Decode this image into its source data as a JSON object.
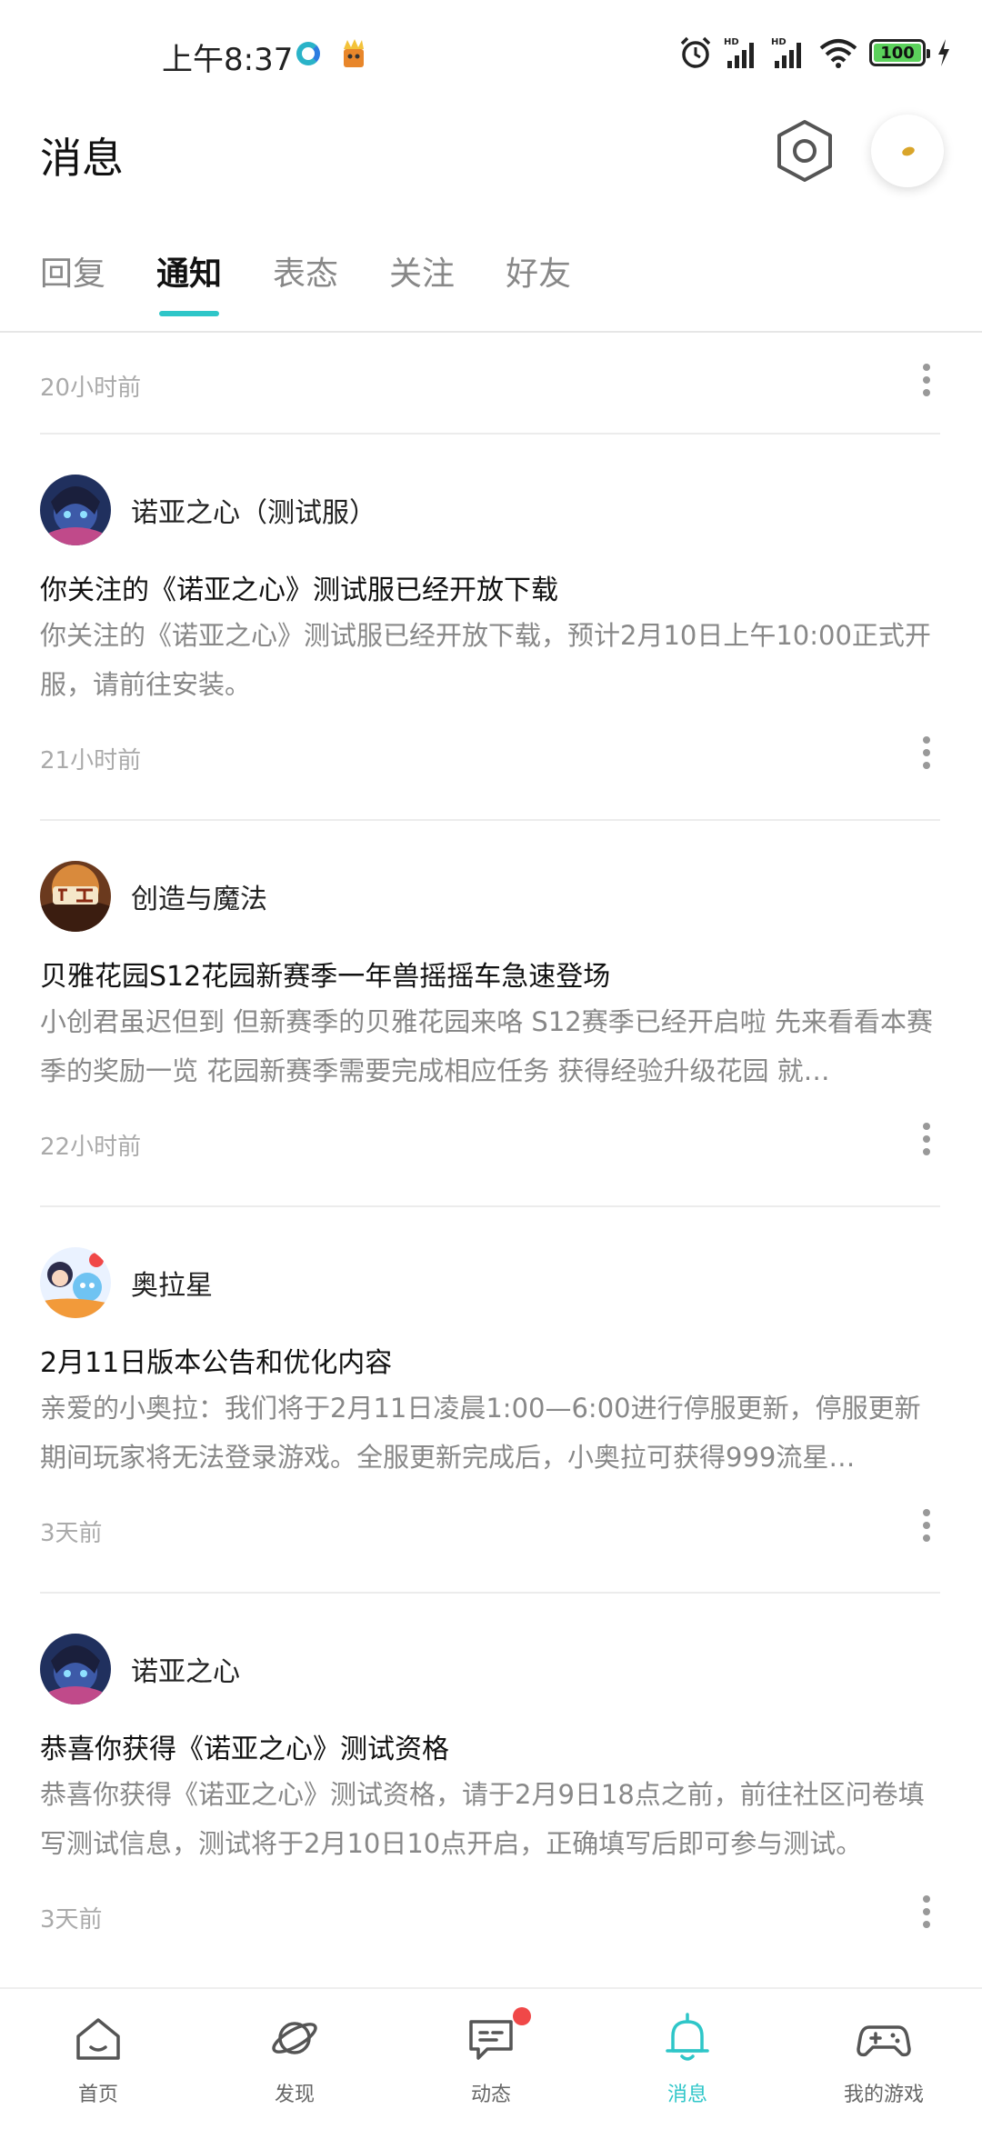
{
  "status_bar": {
    "time": "上午8:37",
    "battery": "100",
    "battery_level_percent": 100,
    "icons": [
      "browser-app-icon",
      "game-app-icon",
      "alarm-icon",
      "hd-signal-icon",
      "hd-signal-icon",
      "wifi-icon",
      "battery-icon",
      "charging-icon"
    ]
  },
  "header": {
    "title": "消息",
    "settings_icon": "hexagon-settings-icon"
  },
  "tabs": [
    {
      "label": "回复",
      "active": false
    },
    {
      "label": "通知",
      "active": true
    },
    {
      "label": "表态",
      "active": false
    },
    {
      "label": "关注",
      "active": false
    },
    {
      "label": "好友",
      "active": false
    }
  ],
  "feed": {
    "top_time": "20小时前",
    "items": [
      {
        "sender": "诺亚之心（测试服）",
        "title": "你关注的《诺亚之心》测试服已经开放下载",
        "body": "你关注的《诺亚之心》测试服已经开放下载，预计2月10日上午10:00正式开服，请前往安装。",
        "time": "21小时前"
      },
      {
        "sender": "创造与魔法",
        "title": "贝雅花园S12花园新赛季一年兽摇摇车急速登场",
        "body": "小创君虽迟但到 但新赛季的贝雅花园来咯 S12赛季已经开启啦 先来看看本赛季的奖励一览 花园新赛季需要完成相应任务 获得经验升级花园 就…",
        "time": "22小时前"
      },
      {
        "sender": "奥拉星",
        "title": "2月11日版本公告和优化内容",
        "body": "亲爱的小奥拉：我们将于2月11日凌晨1:00—6:00进行停服更新，停服更新期间玩家将无法登录游戏。全服更新完成后，小奥拉可获得999流星…",
        "time": "3天前"
      },
      {
        "sender": "诺亚之心",
        "title": "恭喜你获得《诺亚之心》测试资格",
        "body": "恭喜你获得《诺亚之心》测试资格，请于2月9日18点之前，前往社区问卷填写测试信息，测试将于2月10日10点开启，正确填写后即可参与测试。",
        "time": "3天前"
      }
    ]
  },
  "bottom_nav": [
    {
      "label": "首页",
      "icon": "home-icon",
      "active": false
    },
    {
      "label": "发现",
      "icon": "planet-icon",
      "active": false
    },
    {
      "label": "动态",
      "icon": "chat-icon",
      "active": false,
      "badge": true
    },
    {
      "label": "消息",
      "icon": "bell-icon",
      "active": true
    },
    {
      "label": "我的游戏",
      "icon": "gamepad-icon",
      "active": false
    }
  ],
  "colors": {
    "accent": "#2ec6c8",
    "badge": "#f04848",
    "battery": "#5bd15b"
  }
}
